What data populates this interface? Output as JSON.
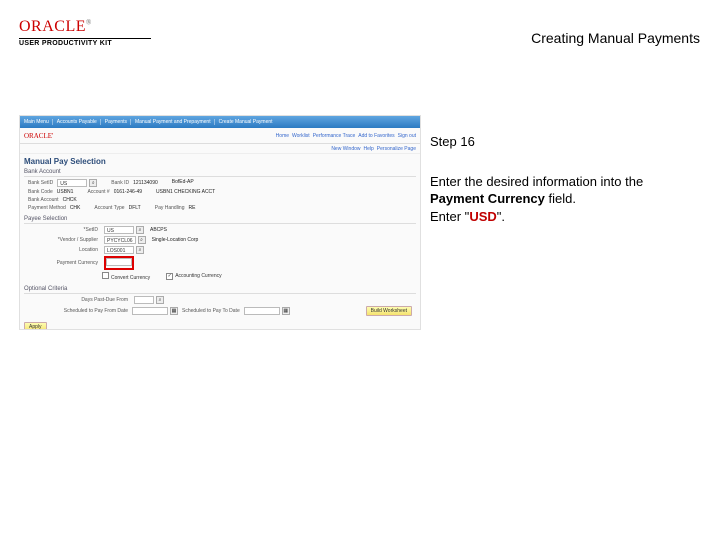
{
  "header": {
    "brand": "ORACLE",
    "trademark": "®",
    "subbrand": "USER PRODUCTIVITY KIT",
    "title": "Creating Manual Payments"
  },
  "instructions": {
    "step_label": "Step 16",
    "line1": "Enter the desired information into the ",
    "bold_field": "Payment Currency",
    "line1b": " field.",
    "line2a": "Enter \"",
    "usd": "USD",
    "line2b": "\"."
  },
  "screenshot": {
    "topnav": [
      "Main Menu",
      "Accounts Payable",
      "Payments",
      "Manual Payment and Prepayment",
      "Create Manual Payment"
    ],
    "topnav_right": [
      "Home",
      "Worklist",
      "Performance Trace",
      "Add to Favorites",
      "Sign out"
    ],
    "brand": "ORACLE'",
    "sub_links": [
      "New Window",
      "Help",
      "Personalize Page"
    ],
    "section_title": "Manual Pay Selection",
    "band1": {
      "title": "Bank Account",
      "rows": [
        [
          {
            "label": "Bank SetID",
            "value": "US",
            "lookup": true
          },
          {
            "label": "Bank ID",
            "value": "121134090"
          },
          {
            "label": "BofEd-AP",
            "plain": true
          }
        ],
        [
          {
            "label": "Bank Code",
            "value": "USBN1"
          },
          {
            "label": "Account #",
            "value": "0161-246-49"
          },
          {
            "label": "USBN1 CHECKING ACCT",
            "plain": true
          }
        ],
        [
          {
            "label": "Bank Account",
            "value": "CHCK"
          }
        ],
        [
          {
            "label": "Payment Method",
            "value": "CHK"
          },
          {
            "label": "Account Type",
            "value": "DFLT"
          },
          {
            "label": "Pay Handling",
            "value": "RE"
          }
        ]
      ]
    },
    "band2": {
      "title": "Payee Selection",
      "rows": [
        {
          "label": "*SetID",
          "value": "US",
          "lookup": true,
          "extra": "ABCPS"
        },
        {
          "label": "*Vendor / Supplier",
          "value": "PYCYCL06",
          "lookup": true,
          "extra": "Single-Location Corp"
        },
        {
          "label": "Location",
          "value": "LOS001",
          "lookup": true
        },
        {
          "label": "Payment Currency",
          "value": "",
          "highlight": true
        }
      ],
      "checks": [
        {
          "label": "Convert Currency",
          "checked": false
        },
        {
          "label": "Accounting Currency",
          "checked": true
        }
      ]
    },
    "band3": {
      "title": "Optional Criteria",
      "rows": [
        {
          "label": "Days Past-Due From",
          "lookup": true
        },
        {
          "label": "Scheduled to Pay From Date",
          "lookup": true,
          "extra_label": "Scheduled to Pay To Date",
          "extra_lookup": true
        }
      ],
      "button": "Build Worksheet"
    },
    "footer_button": "Apply"
  }
}
